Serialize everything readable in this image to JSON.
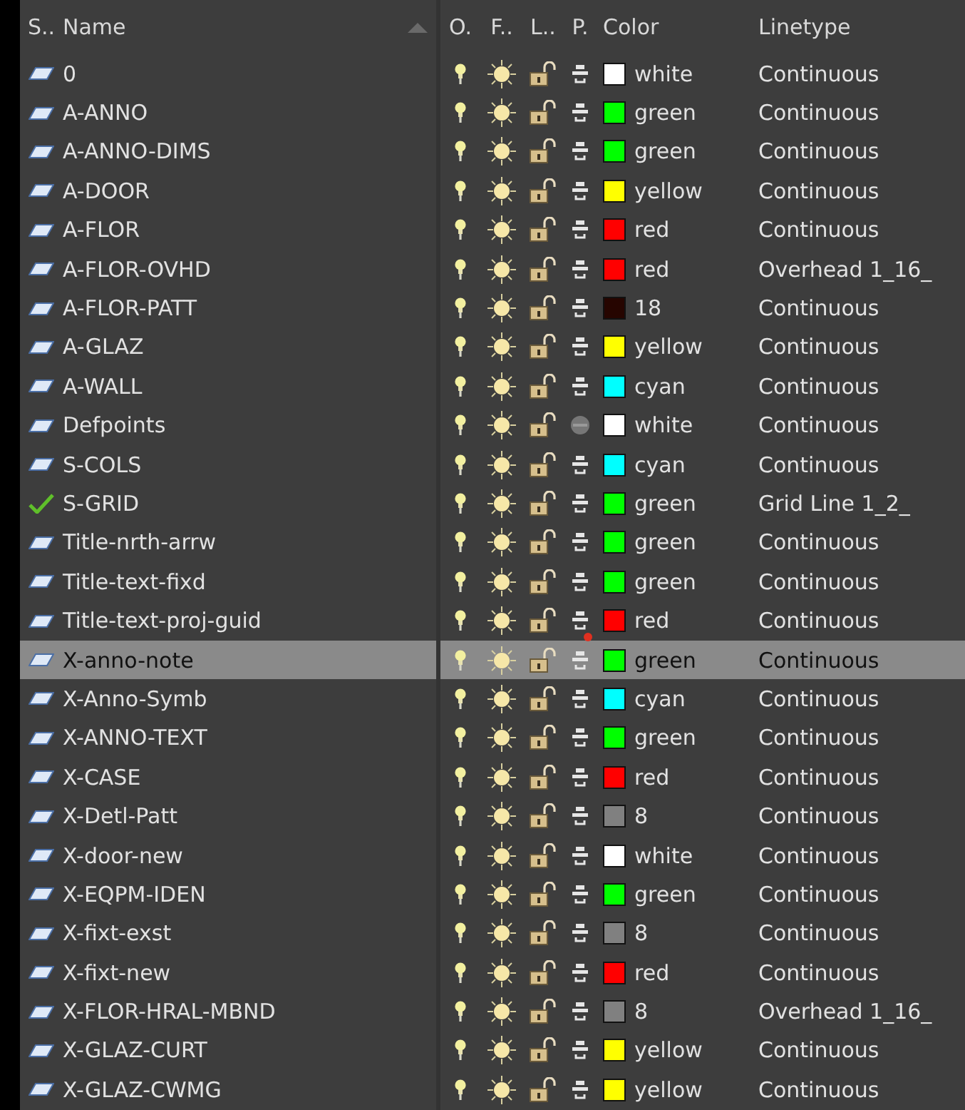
{
  "columns": [
    {
      "label": "S..",
      "sorted": false
    },
    {
      "label": "Name",
      "sorted": true
    },
    {
      "label": "O.",
      "sorted": false
    },
    {
      "label": "F..",
      "sorted": false
    },
    {
      "label": "L..",
      "sorted": false
    },
    {
      "label": "P.",
      "sorted": false
    },
    {
      "label": "Color",
      "sorted": false
    },
    {
      "label": "Linetype",
      "sorted": false
    }
  ],
  "rows": [
    {
      "name": "0",
      "current": false,
      "plot": true,
      "plot_override": false,
      "color_name": "white",
      "color": "#ffffff",
      "linetype": "Continuous",
      "selected": false
    },
    {
      "name": "A-ANNO",
      "current": false,
      "plot": true,
      "plot_override": false,
      "color_name": "green",
      "color": "#00ff00",
      "linetype": "Continuous",
      "selected": false
    },
    {
      "name": "A-ANNO-DIMS",
      "current": false,
      "plot": true,
      "plot_override": false,
      "color_name": "green",
      "color": "#00ff00",
      "linetype": "Continuous",
      "selected": false
    },
    {
      "name": "A-DOOR",
      "current": false,
      "plot": true,
      "plot_override": false,
      "color_name": "yellow",
      "color": "#ffff00",
      "linetype": "Continuous",
      "selected": false
    },
    {
      "name": "A-FLOR",
      "current": false,
      "plot": true,
      "plot_override": false,
      "color_name": "red",
      "color": "#ff0000",
      "linetype": "Continuous",
      "selected": false
    },
    {
      "name": "A-FLOR-OVHD",
      "current": false,
      "plot": true,
      "plot_override": false,
      "color_name": "red",
      "color": "#ff0000",
      "linetype": "Overhead 1_16_",
      "selected": false
    },
    {
      "name": "A-FLOR-PATT",
      "current": false,
      "plot": true,
      "plot_override": false,
      "color_name": "18",
      "color": "#260500",
      "linetype": "Continuous",
      "selected": false
    },
    {
      "name": "A-GLAZ",
      "current": false,
      "plot": true,
      "plot_override": false,
      "color_name": "yellow",
      "color": "#ffff00",
      "linetype": "Continuous",
      "selected": false
    },
    {
      "name": "A-WALL",
      "current": false,
      "plot": true,
      "plot_override": false,
      "color_name": "cyan",
      "color": "#00ffff",
      "linetype": "Continuous",
      "selected": false
    },
    {
      "name": "Defpoints",
      "current": false,
      "plot": false,
      "plot_override": false,
      "color_name": "white",
      "color": "#ffffff",
      "linetype": "Continuous",
      "selected": false
    },
    {
      "name": "S-COLS",
      "current": false,
      "plot": true,
      "plot_override": false,
      "color_name": "cyan",
      "color": "#00ffff",
      "linetype": "Continuous",
      "selected": false
    },
    {
      "name": "S-GRID",
      "current": true,
      "plot": true,
      "plot_override": false,
      "color_name": "green",
      "color": "#00ff00",
      "linetype": "Grid Line 1_2_",
      "selected": false
    },
    {
      "name": "Title-nrth-arrw",
      "current": false,
      "plot": true,
      "plot_override": false,
      "color_name": "green",
      "color": "#00ff00",
      "linetype": "Continuous",
      "selected": false
    },
    {
      "name": "Title-text-fixd",
      "current": false,
      "plot": true,
      "plot_override": false,
      "color_name": "green",
      "color": "#00ff00",
      "linetype": "Continuous",
      "selected": false
    },
    {
      "name": "Title-text-proj-guid",
      "current": false,
      "plot": true,
      "plot_override": true,
      "color_name": "red",
      "color": "#ff0000",
      "linetype": "Continuous",
      "selected": false
    },
    {
      "name": "X-anno-note",
      "current": false,
      "plot": true,
      "plot_override": false,
      "color_name": "green",
      "color": "#00ff00",
      "linetype": "Continuous",
      "selected": true
    },
    {
      "name": "X-Anno-Symb",
      "current": false,
      "plot": true,
      "plot_override": false,
      "color_name": "cyan",
      "color": "#00ffff",
      "linetype": "Continuous",
      "selected": false
    },
    {
      "name": "X-ANNO-TEXT",
      "current": false,
      "plot": true,
      "plot_override": false,
      "color_name": "green",
      "color": "#00ff00",
      "linetype": "Continuous",
      "selected": false
    },
    {
      "name": "X-CASE",
      "current": false,
      "plot": true,
      "plot_override": false,
      "color_name": "red",
      "color": "#ff0000",
      "linetype": "Continuous",
      "selected": false
    },
    {
      "name": "X-Detl-Patt",
      "current": false,
      "plot": true,
      "plot_override": false,
      "color_name": "8",
      "color": "#808080",
      "linetype": "Continuous",
      "selected": false
    },
    {
      "name": "X-door-new",
      "current": false,
      "plot": true,
      "plot_override": false,
      "color_name": "white",
      "color": "#ffffff",
      "linetype": "Continuous",
      "selected": false
    },
    {
      "name": "X-EQPM-IDEN",
      "current": false,
      "plot": true,
      "plot_override": false,
      "color_name": "green",
      "color": "#00ff00",
      "linetype": "Continuous",
      "selected": false
    },
    {
      "name": "X-fixt-exst",
      "current": false,
      "plot": true,
      "plot_override": false,
      "color_name": "8",
      "color": "#808080",
      "linetype": "Continuous",
      "selected": false
    },
    {
      "name": "X-fixt-new",
      "current": false,
      "plot": true,
      "plot_override": false,
      "color_name": "red",
      "color": "#ff0000",
      "linetype": "Continuous",
      "selected": false
    },
    {
      "name": "X-FLOR-HRAL-MBND",
      "current": false,
      "plot": true,
      "plot_override": false,
      "color_name": "8",
      "color": "#808080",
      "linetype": "Overhead 1_16_",
      "selected": false
    },
    {
      "name": "X-GLAZ-CURT",
      "current": false,
      "plot": true,
      "plot_override": false,
      "color_name": "yellow",
      "color": "#ffff00",
      "linetype": "Continuous",
      "selected": false
    },
    {
      "name": "X-GLAZ-CWMG",
      "current": false,
      "plot": true,
      "plot_override": false,
      "color_name": "yellow",
      "color": "#ffff00",
      "linetype": "Continuous",
      "selected": false
    }
  ]
}
